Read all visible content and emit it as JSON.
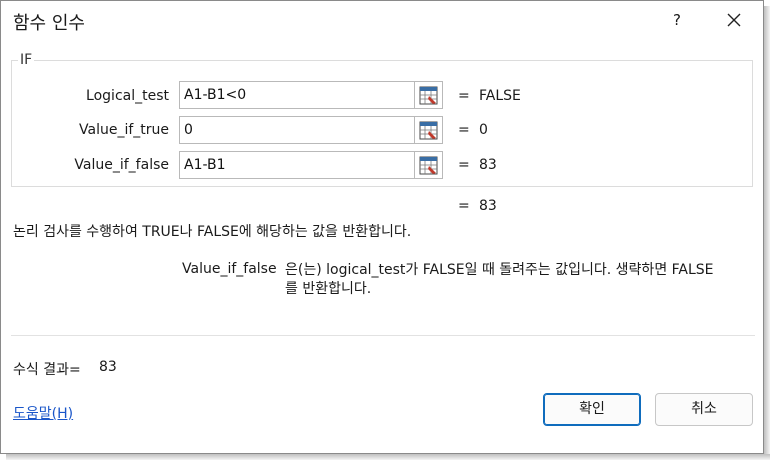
{
  "dialog": {
    "title": "함수 인수",
    "help_glyph": "?",
    "close_icon": "close-icon"
  },
  "function": {
    "name": "IF"
  },
  "args": [
    {
      "label": "Logical_test",
      "value": "A1-B1<0",
      "eq": "=",
      "result": "FALSE"
    },
    {
      "label": "Value_if_true",
      "value": "0",
      "eq": "=",
      "result": "0"
    },
    {
      "label": "Value_if_false",
      "value": "A1-B1",
      "eq": "=",
      "result": "83"
    }
  ],
  "overall": {
    "eq": "=",
    "result": "83"
  },
  "description": "논리 검사를 수행하여 TRUE나 FALSE에 해당하는 값을 반환합니다.",
  "arg_description": {
    "name": "Value_if_false",
    "text": "은(는) logical_test가 FALSE일 때 돌려주는 값입니다. 생략하면 FALSE를 반환합니다."
  },
  "formula_result": {
    "label": "수식 결과=",
    "value": "83"
  },
  "help_link": "도움말(H)",
  "buttons": {
    "ok": "확인",
    "cancel": "취소"
  },
  "colors": {
    "accent": "#0f6cbd",
    "link": "#1a56c9",
    "ref_icon_red": "#c0392b"
  }
}
